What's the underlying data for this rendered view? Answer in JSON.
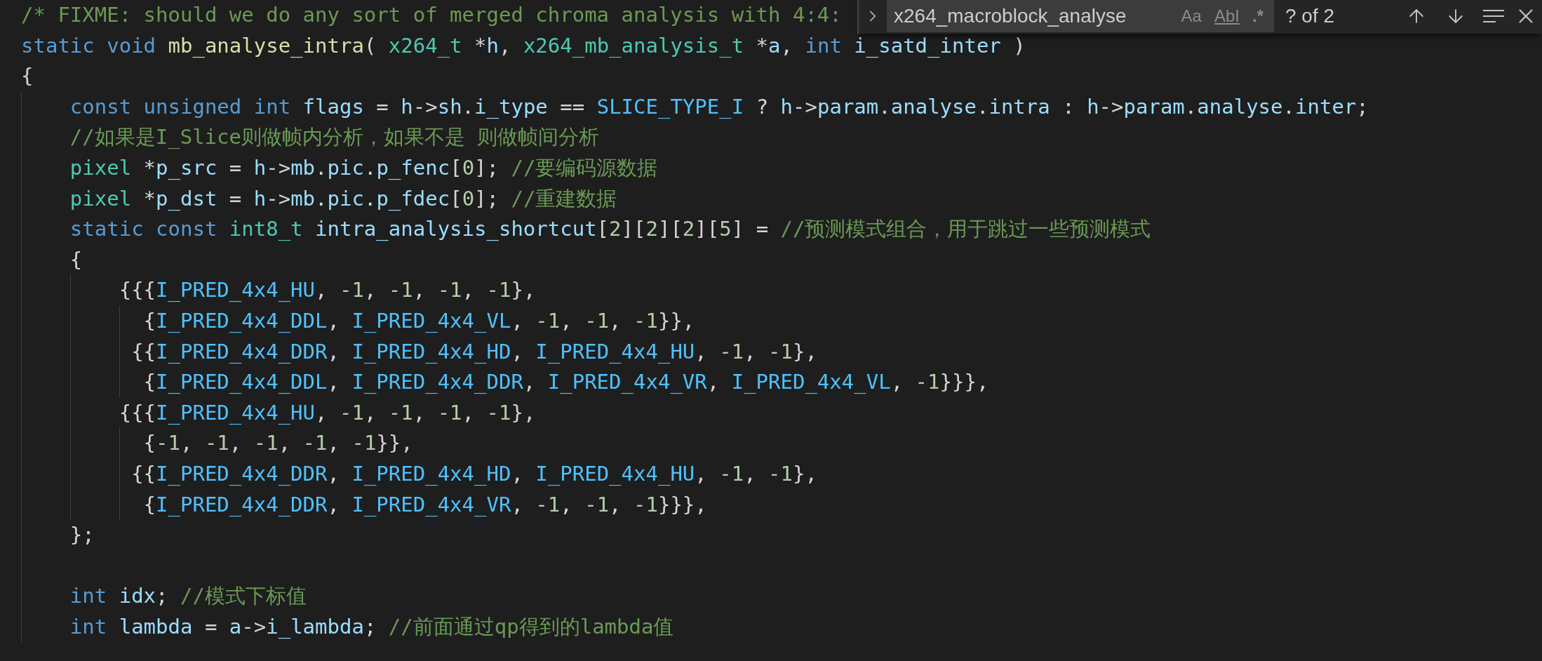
{
  "editor": {
    "lines": [
      {
        "kind": "code",
        "tokens": [
          {
            "kind": "comment",
            "text": "/* FIXME: should we do any sort of merged chroma analysis with 4:4:"
          }
        ]
      },
      {
        "kind": "code",
        "tokens": [
          {
            "kind": "keyword",
            "text": "static void "
          },
          {
            "kind": "function",
            "text": "mb_analyse_intra"
          },
          {
            "kind": "plain",
            "text": "( "
          },
          {
            "kind": "type",
            "text": "x264_t"
          },
          {
            "kind": "plain",
            "text": " *"
          },
          {
            "kind": "variable",
            "text": "h"
          },
          {
            "kind": "plain",
            "text": ", "
          },
          {
            "kind": "type",
            "text": "x264_mb_analysis_t"
          },
          {
            "kind": "plain",
            "text": " *"
          },
          {
            "kind": "variable",
            "text": "a"
          },
          {
            "kind": "plain",
            "text": ", "
          },
          {
            "kind": "keyword",
            "text": "int "
          },
          {
            "kind": "variable",
            "text": "i_satd_inter"
          },
          {
            "kind": "plain",
            "text": " )"
          }
        ]
      },
      {
        "kind": "code",
        "tokens": [
          {
            "kind": "plain",
            "text": "{"
          }
        ]
      },
      {
        "kind": "code",
        "tokens": [
          {
            "kind": "keyword",
            "text": "    const unsigned int "
          },
          {
            "kind": "variable",
            "text": "flags"
          },
          {
            "kind": "plain",
            "text": " = "
          },
          {
            "kind": "variable",
            "text": "h"
          },
          {
            "kind": "plain",
            "text": "->"
          },
          {
            "kind": "variable",
            "text": "sh"
          },
          {
            "kind": "plain",
            "text": "."
          },
          {
            "kind": "variable",
            "text": "i_type"
          },
          {
            "kind": "plain",
            "text": " == "
          },
          {
            "kind": "constant",
            "text": "SLICE_TYPE_I"
          },
          {
            "kind": "plain",
            "text": " ? "
          },
          {
            "kind": "variable",
            "text": "h"
          },
          {
            "kind": "plain",
            "text": "->"
          },
          {
            "kind": "variable",
            "text": "param"
          },
          {
            "kind": "plain",
            "text": "."
          },
          {
            "kind": "variable",
            "text": "analyse"
          },
          {
            "kind": "plain",
            "text": "."
          },
          {
            "kind": "variable",
            "text": "intra"
          },
          {
            "kind": "plain",
            "text": " : "
          },
          {
            "kind": "variable",
            "text": "h"
          },
          {
            "kind": "plain",
            "text": "->"
          },
          {
            "kind": "variable",
            "text": "param"
          },
          {
            "kind": "plain",
            "text": "."
          },
          {
            "kind": "variable",
            "text": "analyse"
          },
          {
            "kind": "plain",
            "text": "."
          },
          {
            "kind": "variable",
            "text": "inter"
          },
          {
            "kind": "plain",
            "text": ";"
          }
        ]
      },
      {
        "kind": "code",
        "tokens": [
          {
            "kind": "comment",
            "text": "    //如果是I_Slice则做帧内分析，如果不是 则做帧间分析"
          }
        ]
      },
      {
        "kind": "code",
        "tokens": [
          {
            "kind": "type",
            "text": "    pixel"
          },
          {
            "kind": "plain",
            "text": " *"
          },
          {
            "kind": "variable",
            "text": "p_src"
          },
          {
            "kind": "plain",
            "text": " = "
          },
          {
            "kind": "variable",
            "text": "h"
          },
          {
            "kind": "plain",
            "text": "->"
          },
          {
            "kind": "variable",
            "text": "mb"
          },
          {
            "kind": "plain",
            "text": "."
          },
          {
            "kind": "variable",
            "text": "pic"
          },
          {
            "kind": "plain",
            "text": "."
          },
          {
            "kind": "variable",
            "text": "p_fenc"
          },
          {
            "kind": "plain",
            "text": "["
          },
          {
            "kind": "number",
            "text": "0"
          },
          {
            "kind": "plain",
            "text": "]; "
          },
          {
            "kind": "comment",
            "text": "//要编码源数据"
          }
        ]
      },
      {
        "kind": "code",
        "tokens": [
          {
            "kind": "type",
            "text": "    pixel"
          },
          {
            "kind": "plain",
            "text": " *"
          },
          {
            "kind": "variable",
            "text": "p_dst"
          },
          {
            "kind": "plain",
            "text": " = "
          },
          {
            "kind": "variable",
            "text": "h"
          },
          {
            "kind": "plain",
            "text": "->"
          },
          {
            "kind": "variable",
            "text": "mb"
          },
          {
            "kind": "plain",
            "text": "."
          },
          {
            "kind": "variable",
            "text": "pic"
          },
          {
            "kind": "plain",
            "text": "."
          },
          {
            "kind": "variable",
            "text": "p_fdec"
          },
          {
            "kind": "plain",
            "text": "["
          },
          {
            "kind": "number",
            "text": "0"
          },
          {
            "kind": "plain",
            "text": "]; "
          },
          {
            "kind": "comment",
            "text": "//重建数据"
          }
        ]
      },
      {
        "kind": "code",
        "tokens": [
          {
            "kind": "keyword",
            "text": "    static const "
          },
          {
            "kind": "type",
            "text": "int8_t "
          },
          {
            "kind": "variable",
            "text": "intra_analysis_shortcut"
          },
          {
            "kind": "plain",
            "text": "["
          },
          {
            "kind": "number",
            "text": "2"
          },
          {
            "kind": "plain",
            "text": "]["
          },
          {
            "kind": "number",
            "text": "2"
          },
          {
            "kind": "plain",
            "text": "]["
          },
          {
            "kind": "number",
            "text": "2"
          },
          {
            "kind": "plain",
            "text": "]["
          },
          {
            "kind": "number",
            "text": "5"
          },
          {
            "kind": "plain",
            "text": "] = "
          },
          {
            "kind": "comment",
            "text": "//预测模式组合，用于跳过一些预测模式"
          }
        ]
      },
      {
        "kind": "code",
        "tokens": [
          {
            "kind": "plain",
            "text": "    {"
          }
        ]
      },
      {
        "kind": "code",
        "tokens": [
          {
            "kind": "plain",
            "text": "        {{{"
          },
          {
            "kind": "constant",
            "text": "I_PRED_4x4_HU"
          },
          {
            "kind": "plain",
            "text": ", "
          },
          {
            "kind": "number",
            "text": "-1"
          },
          {
            "kind": "plain",
            "text": ", "
          },
          {
            "kind": "number",
            "text": "-1"
          },
          {
            "kind": "plain",
            "text": ", "
          },
          {
            "kind": "number",
            "text": "-1"
          },
          {
            "kind": "plain",
            "text": ", "
          },
          {
            "kind": "number",
            "text": "-1"
          },
          {
            "kind": "plain",
            "text": "},"
          }
        ]
      },
      {
        "kind": "code",
        "tokens": [
          {
            "kind": "plain",
            "text": "          {"
          },
          {
            "kind": "constant",
            "text": "I_PRED_4x4_DDL"
          },
          {
            "kind": "plain",
            "text": ", "
          },
          {
            "kind": "constant",
            "text": "I_PRED_4x4_VL"
          },
          {
            "kind": "plain",
            "text": ", "
          },
          {
            "kind": "number",
            "text": "-1"
          },
          {
            "kind": "plain",
            "text": ", "
          },
          {
            "kind": "number",
            "text": "-1"
          },
          {
            "kind": "plain",
            "text": ", "
          },
          {
            "kind": "number",
            "text": "-1"
          },
          {
            "kind": "plain",
            "text": "}},"
          }
        ]
      },
      {
        "kind": "code",
        "tokens": [
          {
            "kind": "plain",
            "text": "         {{"
          },
          {
            "kind": "constant",
            "text": "I_PRED_4x4_DDR"
          },
          {
            "kind": "plain",
            "text": ", "
          },
          {
            "kind": "constant",
            "text": "I_PRED_4x4_HD"
          },
          {
            "kind": "plain",
            "text": ", "
          },
          {
            "kind": "constant",
            "text": "I_PRED_4x4_HU"
          },
          {
            "kind": "plain",
            "text": ", "
          },
          {
            "kind": "number",
            "text": "-1"
          },
          {
            "kind": "plain",
            "text": ", "
          },
          {
            "kind": "number",
            "text": "-1"
          },
          {
            "kind": "plain",
            "text": "},"
          }
        ]
      },
      {
        "kind": "code",
        "tokens": [
          {
            "kind": "plain",
            "text": "          {"
          },
          {
            "kind": "constant",
            "text": "I_PRED_4x4_DDL"
          },
          {
            "kind": "plain",
            "text": ", "
          },
          {
            "kind": "constant",
            "text": "I_PRED_4x4_DDR"
          },
          {
            "kind": "plain",
            "text": ", "
          },
          {
            "kind": "constant",
            "text": "I_PRED_4x4_VR"
          },
          {
            "kind": "plain",
            "text": ", "
          },
          {
            "kind": "constant",
            "text": "I_PRED_4x4_VL"
          },
          {
            "kind": "plain",
            "text": ", "
          },
          {
            "kind": "number",
            "text": "-1"
          },
          {
            "kind": "plain",
            "text": "}}},"
          }
        ]
      },
      {
        "kind": "code",
        "tokens": [
          {
            "kind": "plain",
            "text": "        {{{"
          },
          {
            "kind": "constant",
            "text": "I_PRED_4x4_HU"
          },
          {
            "kind": "plain",
            "text": ", "
          },
          {
            "kind": "number",
            "text": "-1"
          },
          {
            "kind": "plain",
            "text": ", "
          },
          {
            "kind": "number",
            "text": "-1"
          },
          {
            "kind": "plain",
            "text": ", "
          },
          {
            "kind": "number",
            "text": "-1"
          },
          {
            "kind": "plain",
            "text": ", "
          },
          {
            "kind": "number",
            "text": "-1"
          },
          {
            "kind": "plain",
            "text": "},"
          }
        ]
      },
      {
        "kind": "code",
        "tokens": [
          {
            "kind": "plain",
            "text": "          {"
          },
          {
            "kind": "number",
            "text": "-1"
          },
          {
            "kind": "plain",
            "text": ", "
          },
          {
            "kind": "number",
            "text": "-1"
          },
          {
            "kind": "plain",
            "text": ", "
          },
          {
            "kind": "number",
            "text": "-1"
          },
          {
            "kind": "plain",
            "text": ", "
          },
          {
            "kind": "number",
            "text": "-1"
          },
          {
            "kind": "plain",
            "text": ", "
          },
          {
            "kind": "number",
            "text": "-1"
          },
          {
            "kind": "plain",
            "text": "}},"
          }
        ]
      },
      {
        "kind": "code",
        "tokens": [
          {
            "kind": "plain",
            "text": "         {{"
          },
          {
            "kind": "constant",
            "text": "I_PRED_4x4_DDR"
          },
          {
            "kind": "plain",
            "text": ", "
          },
          {
            "kind": "constant",
            "text": "I_PRED_4x4_HD"
          },
          {
            "kind": "plain",
            "text": ", "
          },
          {
            "kind": "constant",
            "text": "I_PRED_4x4_HU"
          },
          {
            "kind": "plain",
            "text": ", "
          },
          {
            "kind": "number",
            "text": "-1"
          },
          {
            "kind": "plain",
            "text": ", "
          },
          {
            "kind": "number",
            "text": "-1"
          },
          {
            "kind": "plain",
            "text": "},"
          }
        ]
      },
      {
        "kind": "code",
        "tokens": [
          {
            "kind": "plain",
            "text": "          {"
          },
          {
            "kind": "constant",
            "text": "I_PRED_4x4_DDR"
          },
          {
            "kind": "plain",
            "text": ", "
          },
          {
            "kind": "constant",
            "text": "I_PRED_4x4_VR"
          },
          {
            "kind": "plain",
            "text": ", "
          },
          {
            "kind": "number",
            "text": "-1"
          },
          {
            "kind": "plain",
            "text": ", "
          },
          {
            "kind": "number",
            "text": "-1"
          },
          {
            "kind": "plain",
            "text": ", "
          },
          {
            "kind": "number",
            "text": "-1"
          },
          {
            "kind": "plain",
            "text": "}}},"
          }
        ]
      },
      {
        "kind": "code",
        "tokens": [
          {
            "kind": "plain",
            "text": "    };"
          }
        ]
      },
      {
        "kind": "blank"
      },
      {
        "kind": "code",
        "tokens": [
          {
            "kind": "keyword",
            "text": "    int "
          },
          {
            "kind": "variable",
            "text": "idx"
          },
          {
            "kind": "plain",
            "text": "; "
          },
          {
            "kind": "comment",
            "text": "//模式下标值"
          }
        ]
      },
      {
        "kind": "code",
        "tokens": [
          {
            "kind": "keyword",
            "text": "    int "
          },
          {
            "kind": "variable",
            "text": "lambda"
          },
          {
            "kind": "plain",
            "text": " = "
          },
          {
            "kind": "variable",
            "text": "a"
          },
          {
            "kind": "plain",
            "text": "->"
          },
          {
            "kind": "variable",
            "text": "i_lambda"
          },
          {
            "kind": "plain",
            "text": "; "
          },
          {
            "kind": "comment",
            "text": "//前面通过qp得到的lambda值"
          }
        ]
      }
    ]
  },
  "find_widget": {
    "query": "x264_macroblock_analyse",
    "toggles": [
      {
        "kind": "case",
        "label": "Aa",
        "selected": false
      },
      {
        "kind": "word",
        "label": "AbI",
        "selected": false
      },
      {
        "kind": "regex",
        "label": ".*",
        "selected": false
      }
    ],
    "match_count": "? of 2"
  }
}
